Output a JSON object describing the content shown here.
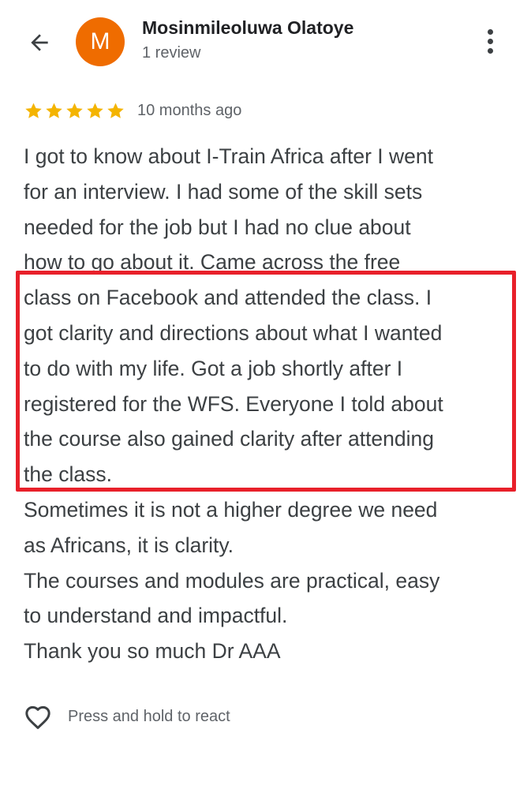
{
  "header": {
    "avatar_letter": "M",
    "reviewer_name": "Mosinmileoluwa Olatoye",
    "review_count": "1 review",
    "avatar_color": "#ef6c00"
  },
  "review": {
    "rating": 5,
    "max_rating": 5,
    "time": "10 months ago",
    "star_color": "#f4b400",
    "lines": [
      "I got to know about I-Train Africa after I went",
      "for an interview. I had some of the skill sets",
      "needed for the job but I had no clue about",
      "how to go about it. Came across the free",
      "class on Facebook and attended the class. I",
      "got clarity and directions about what I wanted",
      "to do with my life. Got a job shortly after I",
      "registered for the WFS. Everyone I told about",
      "the course also gained clarity after attending",
      "the class.",
      "Sometimes it is not a higher degree we need",
      "as Africans, it is clarity.",
      "The courses and modules are practical, easy",
      "to understand and impactful.",
      "Thank you so much Dr AAA"
    ],
    "highlight_color": "#e8202a"
  },
  "react": {
    "label": "Press and hold to react"
  },
  "icons": {
    "back": "arrow-back-icon",
    "more": "more-vert-icon",
    "star": "star-icon",
    "heart": "heart-outline-icon"
  }
}
